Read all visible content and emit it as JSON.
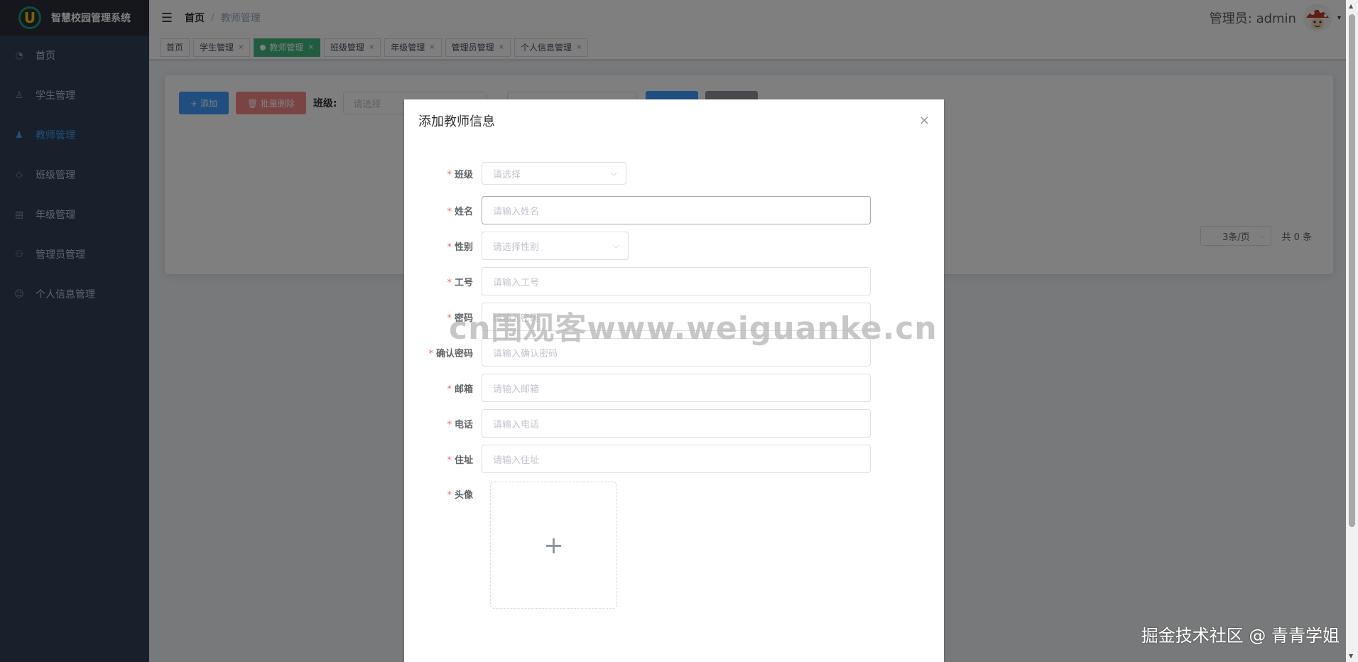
{
  "app": {
    "title": "智慧校园管理系统",
    "logo_letter": "U"
  },
  "sidebar": {
    "items": [
      {
        "label": "首页",
        "icon": "dashboard-icon",
        "glyph": "◔"
      },
      {
        "label": "学生管理",
        "icon": "user-icon",
        "glyph": "♙"
      },
      {
        "label": "教师管理",
        "icon": "teacher-icon",
        "glyph": "♟"
      },
      {
        "label": "班级管理",
        "icon": "tag-icon",
        "glyph": "◇"
      },
      {
        "label": "年级管理",
        "icon": "calendar-icon",
        "glyph": "▤"
      },
      {
        "label": "管理员管理",
        "icon": "admin-icon",
        "glyph": "⚇"
      },
      {
        "label": "个人信息管理",
        "icon": "profile-icon",
        "glyph": "☺"
      }
    ],
    "active_index": 2
  },
  "header": {
    "hamburger": "☰",
    "breadcrumb": {
      "home": "首页",
      "separator": "/",
      "current": "教师管理"
    },
    "user_label": "管理员: admin",
    "caret": "▾"
  },
  "tags": [
    {
      "label": "首页",
      "closable": false,
      "active": false
    },
    {
      "label": "学生管理",
      "closable": true,
      "active": false
    },
    {
      "label": "教师管理",
      "closable": true,
      "active": true
    },
    {
      "label": "班级管理",
      "closable": true,
      "active": false
    },
    {
      "label": "年级管理",
      "closable": true,
      "active": false
    },
    {
      "label": "管理员管理",
      "closable": true,
      "active": false
    },
    {
      "label": "个人信息管理",
      "closable": true,
      "active": false
    }
  ],
  "toolbar": {
    "add_label": "+ 添加",
    "batch_delete_label": "🗑 批量删除",
    "class_filter_label": "班级:",
    "class_filter_placeholder": "请选择"
  },
  "pagination": {
    "page_size": "3条/页",
    "total": "共 0 条"
  },
  "dialog": {
    "title": "添加教师信息",
    "close": "×",
    "fields": [
      {
        "label": "班级",
        "placeholder": "请选择",
        "type": "select-sm"
      },
      {
        "label": "姓名",
        "placeholder": "请输入姓名",
        "type": "input-active"
      },
      {
        "label": "性别",
        "placeholder": "请选择性别",
        "type": "select-md"
      },
      {
        "label": "工号",
        "placeholder": "请输入工号",
        "type": "input"
      },
      {
        "label": "密码",
        "placeholder": "请输入密码",
        "type": "input"
      },
      {
        "label": "确认密码",
        "placeholder": "请输入确认密码",
        "type": "input"
      },
      {
        "label": "邮箱",
        "placeholder": "请输入邮箱",
        "type": "input"
      },
      {
        "label": "电话",
        "placeholder": "请输入电话",
        "type": "input"
      },
      {
        "label": "住址",
        "placeholder": "请输入住址",
        "type": "input"
      }
    ],
    "avatar_label": "头像",
    "upload_glyph": "+",
    "required_mark": "*"
  },
  "watermarks": {
    "center": "cn围观客www.weiguanke.cn",
    "corner": "掘金技术社区 @ 青青学姐"
  },
  "colors": {
    "sidebar_bg": "#304156",
    "active": "#409eff",
    "tag_active": "#42b983",
    "danger": "#f78989",
    "required": "#f56c6c"
  }
}
